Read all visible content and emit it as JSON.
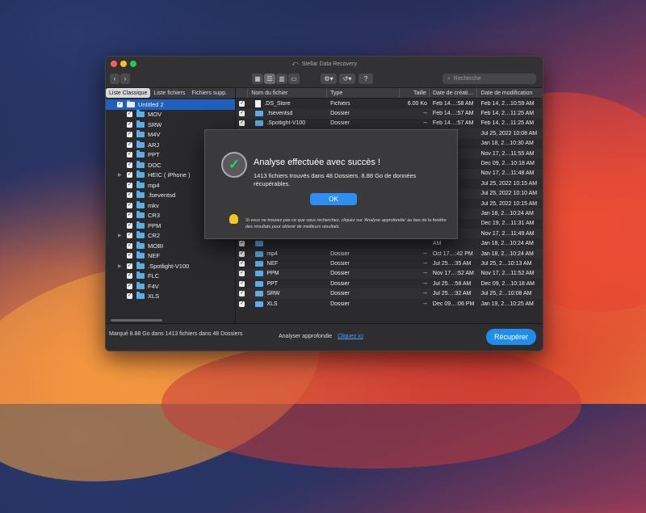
{
  "window": {
    "title": "Stellar Data Recovery"
  },
  "toolbar": {
    "search_placeholder": "Recherche",
    "help_label": "?"
  },
  "sidebar": {
    "tabs": [
      "Liste Classique",
      "Liste fichiers",
      "Fichiers supp."
    ],
    "root": "Untitled 2",
    "items": [
      "MOV",
      "SRW",
      "M4V",
      "ARJ",
      "PPT",
      "DOC",
      "HEIC ( iPhone )",
      "mp4",
      ".fseventsd",
      "mkv",
      "CR3",
      "PPM",
      "CR2",
      "MOBI",
      "NEF",
      ".Spotlight-V100",
      "FLC",
      "F4V",
      "XLS"
    ]
  },
  "table": {
    "headers": [
      "Nom du fichier",
      "Type",
      "Taille",
      "Date de créati…",
      "Date de modification"
    ],
    "rows": [
      {
        "name": ".DS_Store",
        "type": "Fichiers",
        "size": "6.00 Ko",
        "created": "Feb 14…:58 AM",
        "modified": "Feb 14, 2…10:59 AM",
        "icon": "file"
      },
      {
        "name": ".fseventsd",
        "type": "Dossier",
        "size": "--",
        "created": "Feb 14…:57 AM",
        "modified": "Feb 14, 2…11:25 AM",
        "icon": "folder"
      },
      {
        "name": ".Spotlight-V100",
        "type": "Dossier",
        "size": "--",
        "created": "Feb 14…:57 AM",
        "modified": "Feb 14, 2…11:25 AM",
        "icon": "folder"
      },
      {
        "name": "",
        "type": "",
        "size": "",
        "created": "AM",
        "modified": "Jul 25, 2022 10:08 AM",
        "icon": "folder"
      },
      {
        "name": "",
        "type": "",
        "size": "",
        "created": "AM",
        "modified": "Jan 18, 2…10:30 AM",
        "icon": "folder"
      },
      {
        "name": "",
        "type": "",
        "size": "",
        "created": "AM",
        "modified": "Nov 17, 2…11:55 AM",
        "icon": "folder"
      },
      {
        "name": "",
        "type": "",
        "size": "",
        "created": "AM",
        "modified": "Dec 09, 2…10:18 AM",
        "icon": "folder"
      },
      {
        "name": "",
        "type": "",
        "size": "",
        "created": "AM",
        "modified": "Nov 17, 2…11:48 AM",
        "icon": "folder"
      },
      {
        "name": "",
        "type": "",
        "size": "",
        "created": "AM",
        "modified": "Jul 25, 2022 10:15 AM",
        "icon": "folder"
      },
      {
        "name": "",
        "type": "",
        "size": "",
        "created": "AM",
        "modified": "Jul 25, 2022 10:10 AM",
        "icon": "folder"
      },
      {
        "name": "",
        "type": "",
        "size": "",
        "created": "AM",
        "modified": "Jul 25, 2022 10:15 AM",
        "icon": "folder"
      },
      {
        "name": "",
        "type": "",
        "size": "",
        "created": "AM",
        "modified": "Jan 18, 2…10:24 AM",
        "icon": "folder"
      },
      {
        "name": "",
        "type": "",
        "size": "",
        "created": "AM",
        "modified": "Dec 19, 2…11:31 AM",
        "icon": "folder"
      },
      {
        "name": "",
        "type": "",
        "size": "",
        "created": "AM",
        "modified": "Nov 17, 2…11:49 AM",
        "icon": "folder"
      },
      {
        "name": "",
        "type": "",
        "size": "",
        "created": "AM",
        "modified": "Jan 18, 2…10:24 AM",
        "icon": "folder"
      },
      {
        "name": "mp4",
        "type": "Dossier",
        "size": "--",
        "created": "Oct 17…:42 PM",
        "modified": "Jan 18, 2…10:24 AM",
        "icon": "folder"
      },
      {
        "name": "NEF",
        "type": "Dossier",
        "size": "--",
        "created": "Jul 25…:35 AM",
        "modified": "Jul 25, 2…10:13 AM",
        "icon": "folder"
      },
      {
        "name": "PPM",
        "type": "Dossier",
        "size": "--",
        "created": "Nov 17…:52 AM",
        "modified": "Nov 17, 2…11:52 AM",
        "icon": "folder"
      },
      {
        "name": "PPT",
        "type": "Dossier",
        "size": "--",
        "created": "Jul 25…:58 AM",
        "modified": "Dec 09, 2…10:18 AM",
        "icon": "folder"
      },
      {
        "name": "SRW",
        "type": "Dossier",
        "size": "--",
        "created": "Jul 25…:32 AM",
        "modified": "Jul 25, 2…10:08 AM",
        "icon": "folder"
      },
      {
        "name": "XLS",
        "type": "Dossier",
        "size": "--",
        "created": "Dec 09…:06 PM",
        "modified": "Jan 19, 2…10:25 AM",
        "icon": "folder"
      }
    ]
  },
  "footer": {
    "status": "Marqué 8.88 Go dans 1413 fichiers dans 48 Dossiers",
    "deep_scan_label": "Analyser approfondie",
    "deep_scan_link": "Cliquez ici",
    "recover_label": "Récupérer"
  },
  "modal": {
    "title": "Analyse effectuée avec succès !",
    "message": "1413 fichiers trouvés dans 48 Dossiers. 8.88 Go de données récupérables.",
    "ok_label": "OK",
    "tip": "Si vous ne trouvez pas ce que vous recherchez, cliquez sur 'Analyse approfondie' au bas de la fenêtre des résultats pour obtenir de meilleurs résultats."
  },
  "colors": {
    "accent": "#1e8eea",
    "selection": "#1e5fbf",
    "success": "#2fcf5f",
    "folder": "#5aaee8"
  }
}
